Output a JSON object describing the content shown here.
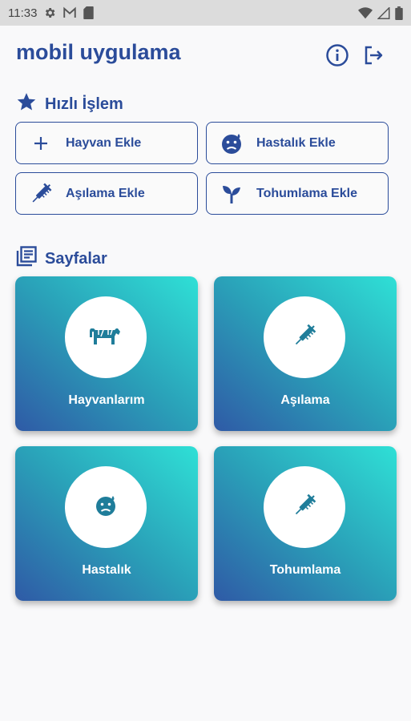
{
  "status_bar": {
    "time": "11:33",
    "icons": [
      "gear-icon",
      "gmail-icon",
      "sd-card-icon",
      "wifi-icon",
      "signal-icon",
      "battery-icon"
    ]
  },
  "header": {
    "title": "mobil uygulama",
    "icons": [
      "info-icon",
      "logout-icon"
    ]
  },
  "quick_actions": {
    "heading": "Hızlı İşlem",
    "heading_icon": "star-icon",
    "items": [
      {
        "label": "Hayvan Ekle",
        "icon": "plus-icon"
      },
      {
        "label": "Hastalık Ekle",
        "icon": "sick-face-icon"
      },
      {
        "label": "Aşılama Ekle",
        "icon": "syringe-icon"
      },
      {
        "label": "Tohumlama Ekle",
        "icon": "sprout-icon"
      }
    ]
  },
  "pages": {
    "heading": "Sayfalar",
    "heading_icon": "library-books-icon",
    "cards": [
      {
        "label": "Hayvanlarım",
        "icon": "cow-icon"
      },
      {
        "label": "Aşılama",
        "icon": "syringe-icon"
      },
      {
        "label": "Hastalık",
        "icon": "sick-face-icon"
      },
      {
        "label": "Tohumlama",
        "icon": "syringe-icon"
      }
    ]
  },
  "colors": {
    "primary": "#2b4c9a",
    "card_gradient_start": "#2f5aa6",
    "card_gradient_end": "#2fe0d6",
    "background": "#f9f9fa"
  }
}
